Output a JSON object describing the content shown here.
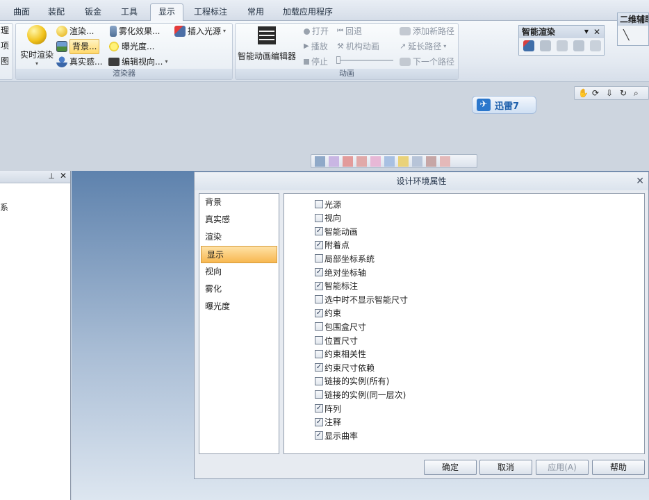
{
  "tabs": [
    "曲面",
    "装配",
    "钣金",
    "工具",
    "显示",
    "工程标注",
    "常用",
    "加载应用程序"
  ],
  "active_tab": "显示",
  "ribbon": {
    "left_cut": [
      "理",
      "项",
      "图"
    ],
    "render_group": {
      "big_button": "实时渲染",
      "items": [
        "渲染...",
        "背景...",
        "真实感...",
        "雾化效果...",
        "曝光度...",
        "编辑视向...",
        "插入光源"
      ],
      "label": "渲染器"
    },
    "animation_group": {
      "big_button": "智能动画编辑器",
      "items": [
        "打开",
        "播放",
        "停止",
        "回退",
        "机构动画",
        "添加新路径",
        "延长路径",
        "下一个路径"
      ],
      "label": "动画"
    },
    "smart_render_panel": {
      "title": "智能渲染"
    },
    "right_cut_title": "二维辅助"
  },
  "xunlei": {
    "label": "迅雷7"
  },
  "dialog": {
    "title": "设计环境属性",
    "nav": [
      "背景",
      "真实感",
      "渲染",
      "显示",
      "视向",
      "雾化",
      "曝光度"
    ],
    "active_nav": "显示",
    "options": [
      {
        "label": "光源",
        "checked": false
      },
      {
        "label": "视向",
        "checked": false
      },
      {
        "label": "智能动画",
        "checked": true
      },
      {
        "label": "附着点",
        "checked": true
      },
      {
        "label": "局部坐标系统",
        "checked": false
      },
      {
        "label": "绝对坐标轴",
        "checked": true
      },
      {
        "label": "智能标注",
        "checked": true
      },
      {
        "label": "选中时不显示智能尺寸",
        "checked": false
      },
      {
        "label": "约束",
        "checked": true
      },
      {
        "label": "包围盒尺寸",
        "checked": false
      },
      {
        "label": "位置尺寸",
        "checked": false
      },
      {
        "label": "约束相关性",
        "checked": false
      },
      {
        "label": "约束尺寸依赖",
        "checked": true
      },
      {
        "label": "链接的实例(所有)",
        "checked": false
      },
      {
        "label": "链接的实例(同一层次)",
        "checked": false
      },
      {
        "label": "阵列",
        "checked": true
      },
      {
        "label": "注释",
        "checked": true
      },
      {
        "label": "显示曲率",
        "checked": true
      }
    ],
    "buttons": {
      "ok": "确定",
      "cancel": "取消",
      "apply": "应用(A)",
      "help": "帮助"
    }
  },
  "left_panel": {
    "text": "系"
  }
}
